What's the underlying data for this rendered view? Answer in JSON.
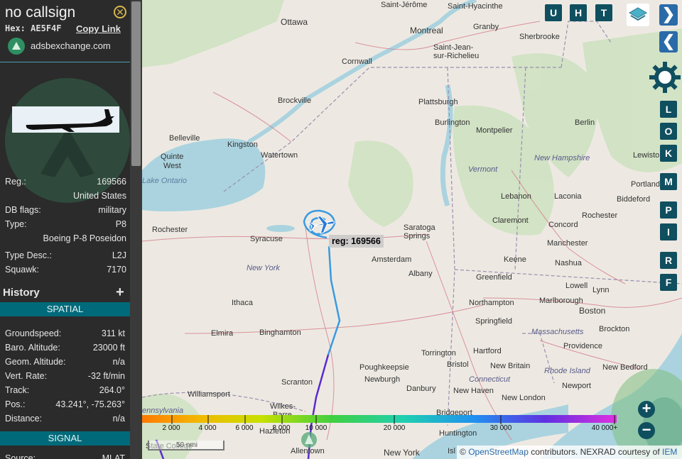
{
  "sidebar": {
    "callsign": "no callsign",
    "hex_label": "Hex:",
    "hex_value": "AE5F4F",
    "copy_link": "Copy Link",
    "source_site": "adsbexchange.com",
    "details": [
      {
        "label": "Reg.:",
        "value": "169566"
      },
      {
        "label": "",
        "value": "United States"
      },
      {
        "label": "DB flags:",
        "value": "military"
      },
      {
        "label": "Type:",
        "value": "P8"
      },
      {
        "label": "",
        "value": "Boeing P-8 Poseidon"
      },
      {
        "label": "Type Desc.:",
        "value": "L2J"
      },
      {
        "label": "Squawk:",
        "value": "7170"
      }
    ],
    "history_label": "History",
    "history_toggle": "+",
    "spatial_header": "SPATIAL",
    "spatial": [
      {
        "label": "Groundspeed:",
        "value": "311 kt"
      },
      {
        "label": "Baro. Altitude:",
        "value": "23000 ft"
      },
      {
        "label": "Geom. Altitude:",
        "value": "n/a"
      },
      {
        "label": "Vert. Rate:",
        "value": "-32 ft/min"
      },
      {
        "label": "Track:",
        "value": "264.0°"
      },
      {
        "label": "Pos.:",
        "value": "43.241°, -75.263°"
      },
      {
        "label": "Distance:",
        "value": "n/a"
      }
    ],
    "signal_header": "SIGNAL",
    "signal": [
      {
        "label": "Source:",
        "value": "MLAT"
      }
    ]
  },
  "map": {
    "aircraft_label": "reg: 169566",
    "top_buttons": [
      "U",
      "H",
      "T"
    ],
    "side_buttons": [
      "L",
      "O",
      "K",
      "M",
      "P",
      "I",
      "R",
      "F"
    ],
    "nav_forward": "❯",
    "nav_back": "❮",
    "zoom_in": "+",
    "zoom_out": "−",
    "scale": "50 nmi",
    "attribution_prefix": "©",
    "attribution_link1": "OpenStreetMap",
    "attribution_mid": "contributors. NEXRAD courtesy of",
    "attribution_link2": "IEM",
    "altitude_ticks": [
      "2 000",
      "4 000",
      "6 000",
      "8 000",
      "10 000",
      "20 000",
      "30 000",
      "40 000+"
    ],
    "places": {
      "st_jerome": "Saint-Jérôme",
      "st_hyacinthe": "Saint-Hyacinthe",
      "ottawa": "Ottawa",
      "montreal": "Montreal",
      "granby": "Granby",
      "sherbrooke": "Sherbrooke",
      "st_jean": "Saint-Jean-",
      "st_jean2": "sur-Richelieu",
      "cornwall": "Cornwall",
      "brockville": "Brockville",
      "plattsburgh": "Plattsburgh",
      "burlington": "Burlington",
      "montpelier": "Montpelier",
      "berlin": "Berlin",
      "belleville": "Belleville",
      "kingston": "Kingston",
      "watertown": "Watertown",
      "quinte": "Quinte",
      "west": "West",
      "vermont": "Vermont",
      "new_hampshire": "New Hampshire",
      "lewiston": "Lewiston",
      "lake_ontario": "Lake Ontario",
      "lebanon": "Lebanon",
      "laconia": "Laconia",
      "portland": "Portland",
      "biddeford": "Biddeford",
      "rochester": "Rochester",
      "saratoga": "Saratoga",
      "springs": "Springs",
      "claremont": "Claremont",
      "concord": "Concord",
      "rochester_nh": "Rochester",
      "syracuse": "Syracuse",
      "amsterdam": "Amsterdam",
      "manchester": "Manchester",
      "albany": "Albany",
      "keene": "Keene",
      "nashua": "Nashua",
      "new_york_state": "New York",
      "greenfield": "Greenfield",
      "lowell": "Lowell",
      "lynn": "Lynn",
      "ithaca": "Ithaca",
      "northampton": "Northampton",
      "marlborough": "Marlborough",
      "boston": "Boston",
      "springfield": "Springfield",
      "massachusetts": "Massachusetts",
      "brockton": "Brockton",
      "elmira": "Elmira",
      "binghamton": "Binghamton",
      "torrington": "Torrington",
      "hartford": "Hartford",
      "providence": "Providence",
      "poughkeepsie": "Poughkeepsie",
      "bristol": "Bristol",
      "new_britain": "New Britain",
      "rhode_island": "Rhode Island",
      "new_bedford": "New Bedford",
      "newburgh": "Newburgh",
      "connecticut": "Connecticut",
      "scranton": "Scranton",
      "danbury": "Danbury",
      "new_haven": "New Haven",
      "newport": "Newport",
      "williamsport": "Williamsport",
      "new_london": "New London",
      "pennsylvania": "ennsylvania",
      "wilkes": "Wilkes-",
      "barre": "Barre",
      "bridgeport": "Bridgeport",
      "hazleton": "Hazleton",
      "huntington": "Huntington",
      "state_college": "State College",
      "allentown": "Allentown",
      "new_york_city": "New York",
      "isl": "Isl"
    }
  },
  "colors": {
    "sidebar_bg": "#2b2b2b",
    "section_header": "#006a7a",
    "button_teal": "#0f4f5f",
    "nav_blue": "#2a6aa8",
    "track_low": "#3a9ae0",
    "track_high": "#5a2ad0",
    "aircraft": "#2a7ad6"
  }
}
